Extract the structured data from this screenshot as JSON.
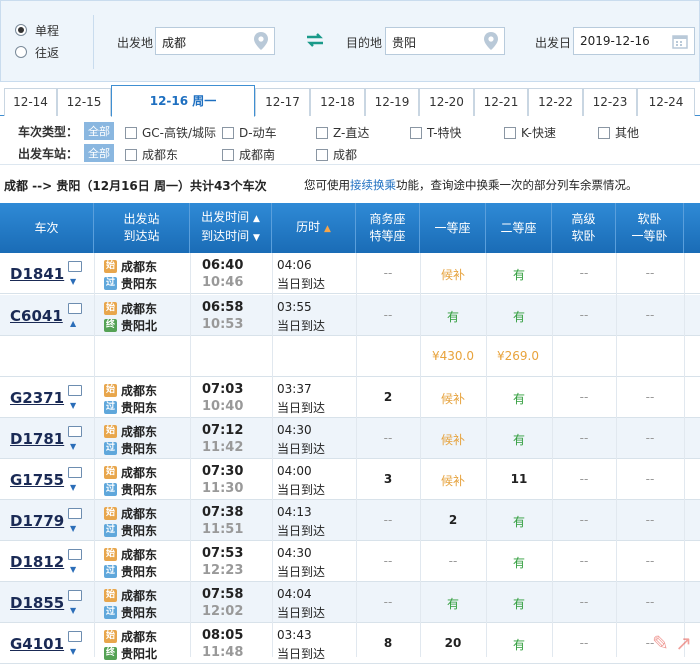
{
  "trip": {
    "oneway": "单程",
    "roundtrip": "往返"
  },
  "search": {
    "from_label": "出发地",
    "from_value": "成都",
    "to_label": "目的地",
    "to_value": "贵阳",
    "date_label": "出发日",
    "date_value": "2019-12-16"
  },
  "dates": [
    "12-14",
    "12-15",
    "12-16 周一",
    "12-17",
    "12-18",
    "12-19",
    "12-20",
    "12-21",
    "12-22",
    "12-23",
    "12-24"
  ],
  "filters": {
    "type_label": "车次类型：",
    "station_label": "出发车站：",
    "all": "全部",
    "types": [
      "GC-高铁/城际",
      "D-动车",
      "Z-直达",
      "T-特快",
      "K-快速",
      "其他"
    ],
    "stations": [
      "成都东",
      "成都南",
      "成都"
    ]
  },
  "summary": {
    "route": "成都 --> 贵阳（12月16日  周一）共计43个车次",
    "hint_pre": "您可使用",
    "hint_link": "接续换乘",
    "hint_post": "功能，查询途中换乘一次的部分列车余票情况。"
  },
  "headers": {
    "train": "车次",
    "stn1": "出发站",
    "stn2": "到达站",
    "time1": "出发时间",
    "time2": "到达时间",
    "dur": "历时",
    "biz1": "商务座",
    "biz2": "特等座",
    "first": "一等座",
    "second": "二等座",
    "hs1": "高级",
    "hs2": "软卧",
    "rw1": "软卧",
    "rw2": "一等卧"
  },
  "start_badge": "始",
  "pass_badge": "过",
  "end_badge": "终",
  "rows": [
    {
      "train": "D1841",
      "from": "成都东",
      "to": "贵阳东",
      "dep": "06:40",
      "arr": "10:46",
      "dur": "04:06",
      "day": "当日到达",
      "biz": "--",
      "first": "候补",
      "second": "有",
      "hs": "--",
      "rw": "--"
    },
    {
      "train": "C6041",
      "from": "成都东",
      "to": "贵阳北",
      "dep": "06:58",
      "arr": "10:53",
      "dur": "03:55",
      "day": "当日到达",
      "biz": "--",
      "first": "有",
      "second": "有",
      "hs": "--",
      "rw": "--"
    },
    {
      "train": "G2371",
      "from": "成都东",
      "to": "贵阳东",
      "dep": "07:03",
      "arr": "10:40",
      "dur": "03:37",
      "day": "当日到达",
      "biz": "2",
      "first": "候补",
      "second": "有",
      "hs": "--",
      "rw": "--"
    },
    {
      "train": "D1781",
      "from": "成都东",
      "to": "贵阳东",
      "dep": "07:12",
      "arr": "11:42",
      "dur": "04:30",
      "day": "当日到达",
      "biz": "--",
      "first": "候补",
      "second": "有",
      "hs": "--",
      "rw": "--"
    },
    {
      "train": "G1755",
      "from": "成都东",
      "to": "贵阳东",
      "dep": "07:30",
      "arr": "11:30",
      "dur": "04:00",
      "day": "当日到达",
      "biz": "3",
      "first": "候补",
      "second": "11",
      "hs": "--",
      "rw": "--"
    },
    {
      "train": "D1779",
      "from": "成都东",
      "to": "贵阳东",
      "dep": "07:38",
      "arr": "11:51",
      "dur": "04:13",
      "day": "当日到达",
      "biz": "--",
      "first": "2",
      "second": "有",
      "hs": "--",
      "rw": "--"
    },
    {
      "train": "D1812",
      "from": "成都东",
      "to": "贵阳东",
      "dep": "07:53",
      "arr": "12:23",
      "dur": "04:30",
      "day": "当日到达",
      "biz": "--",
      "first": "--",
      "second": "有",
      "hs": "--",
      "rw": "--"
    },
    {
      "train": "D1855",
      "from": "成都东",
      "to": "贵阳东",
      "dep": "07:58",
      "arr": "12:02",
      "dur": "04:04",
      "day": "当日到达",
      "biz": "--",
      "first": "有",
      "second": "有",
      "hs": "--",
      "rw": "--"
    },
    {
      "train": "G4101",
      "from": "成都东",
      "to": "贵阳北",
      "dep": "08:05",
      "arr": "11:48",
      "dur": "03:43",
      "day": "当日到达",
      "biz": "8",
      "first": "20",
      "second": "有",
      "hs": "--",
      "rw": "--"
    }
  ],
  "prices": {
    "first": "¥430.0",
    "second": "¥269.0"
  }
}
